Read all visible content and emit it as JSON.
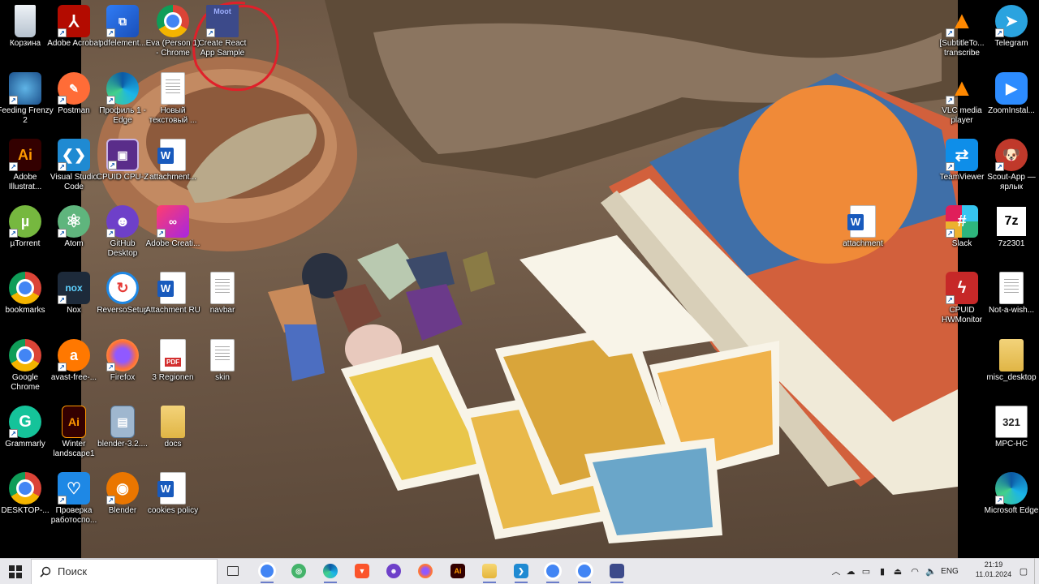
{
  "desktop": {
    "icons_col1": [
      {
        "label": "Корзина",
        "icon": "recycle-bin-icon"
      },
      {
        "label": "Feeding Frenzy 2",
        "icon": "game-icon"
      },
      {
        "label": "Adobe Illustrat...",
        "icon": "illustrator-icon"
      },
      {
        "label": "µTorrent",
        "icon": "utorrent-icon"
      },
      {
        "label": "bookmarks",
        "icon": "chrome-icon"
      },
      {
        "label": "Google Chrome",
        "icon": "chrome-icon"
      },
      {
        "label": "Grammarly",
        "icon": "grammarly-icon"
      },
      {
        "label": "DESKTOP-...",
        "icon": "chrome-icon"
      }
    ],
    "icons_col2": [
      {
        "label": "Adobe Acrobat",
        "icon": "acrobat-icon"
      },
      {
        "label": "Postman",
        "icon": "postman-icon"
      },
      {
        "label": "Visual Studio Code",
        "icon": "vscode-icon"
      },
      {
        "label": "Atom",
        "icon": "atom-icon"
      },
      {
        "label": "Nox",
        "icon": "nox-icon"
      },
      {
        "label": "avast-free-...",
        "icon": "avast-icon"
      },
      {
        "label": "Winter landscape1",
        "icon": "illustrator-file-icon"
      },
      {
        "label": "Проверка работоспо...",
        "icon": "heartbeat-icon"
      }
    ],
    "icons_col3": [
      {
        "label": "pdfelement...",
        "icon": "pdfelement-icon"
      },
      {
        "label": "Профиль 1 - Edge",
        "icon": "edge-icon"
      },
      {
        "label": "CPUID CPU-Z",
        "icon": "cpuz-icon"
      },
      {
        "label": "GitHub Desktop",
        "icon": "github-icon"
      },
      {
        "label": "ReversoSetup",
        "icon": "reverso-icon"
      },
      {
        "label": "Firefox",
        "icon": "firefox-icon"
      },
      {
        "label": "blender-3.2....",
        "icon": "installer-icon"
      },
      {
        "label": "Blender",
        "icon": "blender-icon"
      }
    ],
    "icons_col4": [
      {
        "label": "Eva (Person 1) - Chrome",
        "icon": "chrome-icon"
      },
      {
        "label": "Новый текстовый ...",
        "icon": "text-file-icon"
      },
      {
        "label": "attachment...",
        "icon": "word-icon"
      },
      {
        "label": "Adobe Creati...",
        "icon": "creative-cloud-icon"
      },
      {
        "label": "Attachment RU",
        "icon": "word-icon"
      },
      {
        "label": "3 Regionen",
        "icon": "pdf-icon"
      },
      {
        "label": "docs",
        "icon": "zip-folder-icon"
      },
      {
        "label": "cookies policy",
        "icon": "word-icon"
      }
    ],
    "icons_col5": [
      {
        "label": "Create React App Sample",
        "icon": "moot-app-icon",
        "badge": "Moot"
      },
      {
        "label": "navbar",
        "icon": "text-file-icon"
      },
      {
        "label": "skin",
        "icon": "text-file-icon"
      }
    ],
    "icon_attachment_mid": {
      "label": "attachment",
      "icon": "word-icon"
    },
    "icons_right1": [
      {
        "label": "[SubtitleTo... transcribe",
        "icon": "vlc-icon"
      },
      {
        "label": "VLC media player",
        "icon": "vlc-icon"
      },
      {
        "label": "TeamViewer",
        "icon": "teamviewer-icon"
      },
      {
        "label": "Slack",
        "icon": "slack-icon"
      },
      {
        "label": "CPUID HWMonitor",
        "icon": "hwmonitor-icon"
      }
    ],
    "icons_right2": [
      {
        "label": "Telegram",
        "icon": "telegram-icon"
      },
      {
        "label": "ZoomInstal...",
        "icon": "zoom-icon"
      },
      {
        "label": "Scout-App — ярлык",
        "icon": "scout-icon"
      },
      {
        "label": "7z2301",
        "icon": "7zip-icon"
      },
      {
        "label": "Not-a-wish...",
        "icon": "text-file-icon"
      },
      {
        "label": "misc_desktop",
        "icon": "folder-icon"
      },
      {
        "label": "MPC-HC",
        "icon": "mpc-icon"
      },
      {
        "label": "Microsoft Edge",
        "icon": "edge-icon"
      }
    ]
  },
  "taskbar": {
    "search_placeholder": "Поиск",
    "apps": [
      "task-view-icon",
      "chrome-icon",
      "chrome-green-icon",
      "edge-icon",
      "brave-icon",
      "github-icon",
      "firefox-icon",
      "illustrator-icon",
      "file-explorer-icon",
      "vscode-icon",
      "chrome-icon",
      "chrome-icon",
      "moot-app-icon"
    ],
    "language": "ENG",
    "time": "21:19",
    "date": "11.01.2024"
  },
  "colors": {
    "taskbar_bg": "#e8e8ec",
    "annotation": "#e0202a",
    "accent": "#0078d4"
  }
}
